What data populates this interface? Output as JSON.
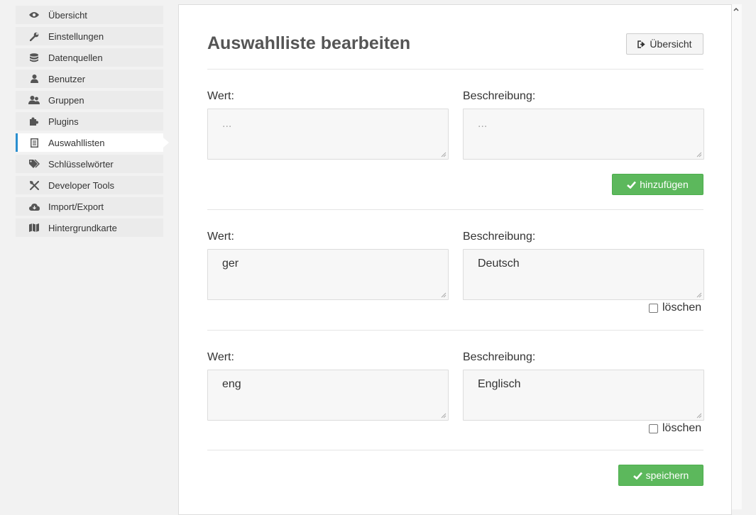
{
  "colors": {
    "accent": "#2a8fcf",
    "success": "#5cb85c"
  },
  "sidebar": {
    "items": [
      {
        "label": "Übersicht",
        "icon": "eye-icon"
      },
      {
        "label": "Einstellungen",
        "icon": "wrench-icon"
      },
      {
        "label": "Datenquellen",
        "icon": "database-icon"
      },
      {
        "label": "Benutzer",
        "icon": "user-icon"
      },
      {
        "label": "Gruppen",
        "icon": "users-icon"
      },
      {
        "label": "Plugins",
        "icon": "puzzle-icon"
      },
      {
        "label": "Auswahllisten",
        "icon": "list-icon",
        "active": true
      },
      {
        "label": "Schlüsselwörter",
        "icon": "tags-icon"
      },
      {
        "label": "Developer Tools",
        "icon": "tools-icon"
      },
      {
        "label": "Import/Export",
        "icon": "cloud-icon"
      },
      {
        "label": "Hintergrundkarte",
        "icon": "map-icon"
      }
    ]
  },
  "main": {
    "title": "Auswahlliste bearbeiten",
    "overview_button": "Übersicht",
    "new_entry": {
      "value_label": "Wert:",
      "description_label": "Beschreibung:",
      "value_placeholder": "...",
      "description_placeholder": "...",
      "add_button": "hinzufügen"
    },
    "entries": [
      {
        "value_label": "Wert:",
        "description_label": "Beschreibung:",
        "value": "ger",
        "description": "Deutsch",
        "delete_label": "löschen"
      },
      {
        "value_label": "Wert:",
        "description_label": "Beschreibung:",
        "value": "eng",
        "description": "Englisch",
        "delete_label": "löschen"
      }
    ],
    "save_button": "speichern"
  }
}
